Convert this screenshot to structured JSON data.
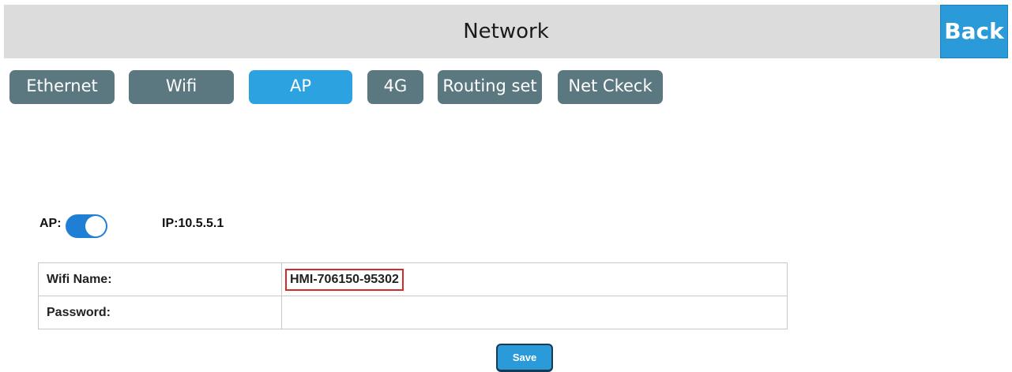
{
  "header": {
    "title": "Network",
    "back_label": "Back"
  },
  "tabs": [
    {
      "label": "Ethernet",
      "active": false
    },
    {
      "label": "Wifi",
      "active": false
    },
    {
      "label": "AP",
      "active": true
    },
    {
      "label": "4G",
      "active": false
    },
    {
      "label": "Routing set",
      "active": false
    },
    {
      "label": "Net Ckeck",
      "active": false
    }
  ],
  "ap": {
    "label": "AP:",
    "enabled": true,
    "ip_text": "IP:10.5.5.1"
  },
  "settings": {
    "wifi_name_label": "Wifi Name:",
    "wifi_name_value": "HMI-706150-95302",
    "password_label": "Password:",
    "password_value": ""
  },
  "save_label": "Save",
  "colors": {
    "accent": "#2b9ad8",
    "tab_inactive": "#5b7880",
    "toggle_on": "#1f7fd4",
    "highlight_box": "#d42a2a"
  }
}
